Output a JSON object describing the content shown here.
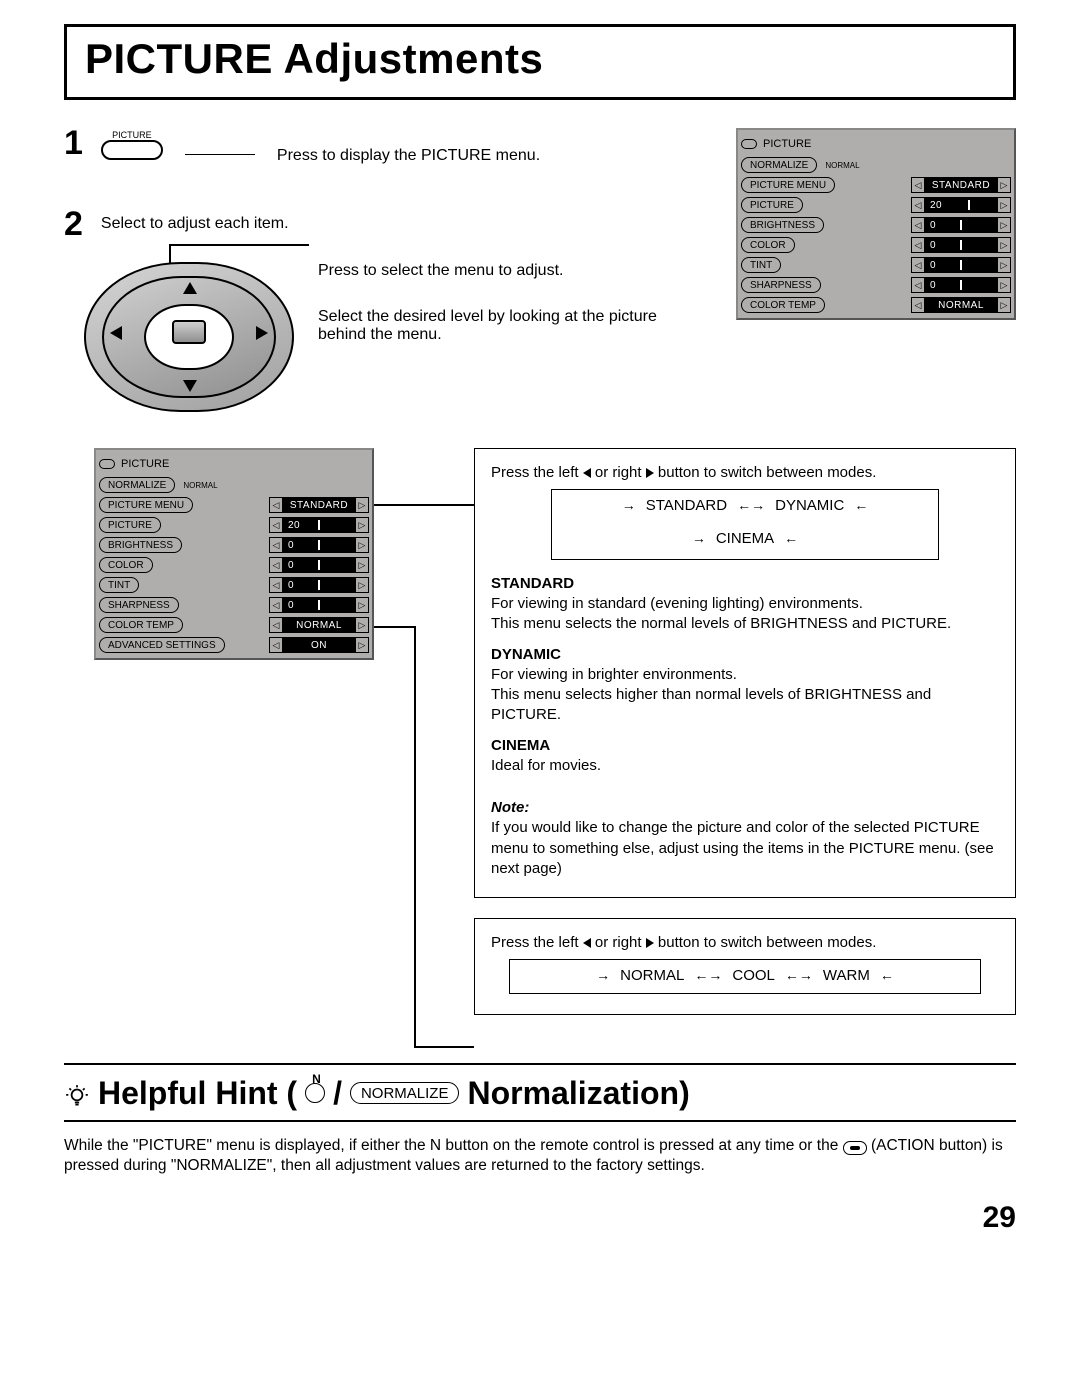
{
  "page": {
    "title": "PICTURE Adjustments",
    "pageNumber": "29"
  },
  "steps": {
    "one": {
      "num": "1",
      "button_label": "PICTURE",
      "text": "Press to display the PICTURE menu."
    },
    "two": {
      "num": "2",
      "intro": "Select to adjust each item.",
      "select_text": "Press to select the menu to adjust.",
      "level_text": "Select the desired level by looking at the picture behind the menu."
    }
  },
  "osd": {
    "title": "PICTURE",
    "normalize_btn": "NORMALIZE",
    "normalize_state": "NORMAL",
    "rows": [
      {
        "label": "PICTURE  MENU",
        "value": "STANDARD",
        "type": "text"
      },
      {
        "label": "PICTURE",
        "value": "20",
        "type": "slider"
      },
      {
        "label": "BRIGHTNESS",
        "value": "0",
        "type": "slider"
      },
      {
        "label": "COLOR",
        "value": "0",
        "type": "slider"
      },
      {
        "label": "TINT",
        "value": "0",
        "type": "slider"
      },
      {
        "label": "SHARPNESS",
        "value": "0",
        "type": "slider"
      },
      {
        "label": "COLOR  TEMP",
        "value": "NORMAL",
        "type": "text"
      }
    ],
    "advanced": {
      "label": "ADVANCED  SETTINGS",
      "value": "ON",
      "type": "text"
    }
  },
  "modes_box": {
    "intro_a": "Press the left ",
    "intro_b": " or right ",
    "intro_c": " button to switch between modes.",
    "cycle": [
      "STANDARD",
      "DYNAMIC",
      "CINEMA"
    ],
    "standard": {
      "head": "STANDARD",
      "body1": "For viewing in standard (evening lighting) environments.",
      "body2": "This menu selects the normal levels of BRIGHTNESS and PICTURE."
    },
    "dynamic": {
      "head": "DYNAMIC",
      "body1": "For viewing in brighter environments.",
      "body2": "This menu selects higher than normal levels of BRIGHTNESS and PICTURE."
    },
    "cinema": {
      "head": "CINEMA",
      "body1": "Ideal for movies."
    },
    "note": {
      "head": "Note:",
      "body": "If you would like to change the picture and color of the selected PICTURE menu to something else, adjust using the items in the PICTURE menu. (see next page)"
    }
  },
  "temp_box": {
    "intro_a": "Press the left ",
    "intro_b": " or right ",
    "intro_c": " button to switch between modes.",
    "cycle": [
      "NORMAL",
      "COOL",
      "WARM"
    ]
  },
  "hint": {
    "prefix": "Helpful Hint (",
    "slash": " / ",
    "badge": "NORMALIZE",
    "suffix": " Normalization)",
    "body_a": "While the \"PICTURE\" menu is displayed, if either the N button on the remote control is pressed at any time or the ",
    "body_b": " (ACTION button) is pressed during \"NORMALIZE\", then all adjustment values are returned to the factory settings."
  }
}
